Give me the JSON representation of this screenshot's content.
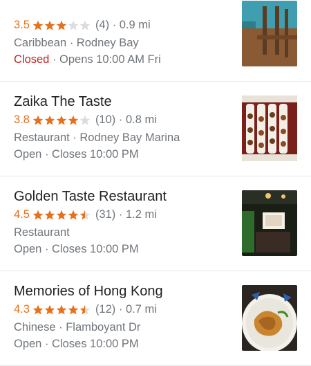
{
  "results": [
    {
      "name": "",
      "rating": "3.5",
      "stars": 3,
      "reviews": "(4)",
      "distance": "0.9 mi",
      "category": "Caribbean · Rodney Bay",
      "status": "Closed",
      "hours": " · Opens 10:00 AM Fri",
      "thumb_icon": "restaurant-interior-photo"
    },
    {
      "name": "Zaika The Taste",
      "rating": "3.8",
      "stars": 4,
      "reviews": "(10)",
      "distance": "0.8 mi",
      "category": "Restaurant · Rodney Bay Marina",
      "status": "Open",
      "hours": " · Closes 10:00 PM",
      "thumb_icon": "food-platter-photo"
    },
    {
      "name": "Golden Taste Restaurant",
      "rating": "4.5",
      "stars": 4.5,
      "reviews": "(31)",
      "distance": "1.2 mi",
      "category": "Restaurant",
      "status": "Open",
      "hours": " · Closes 10:00 PM",
      "thumb_icon": "restaurant-night-photo"
    },
    {
      "name": "Memories of Hong Kong",
      "rating": "4.3",
      "stars": 4.5,
      "reviews": "(12)",
      "distance": "0.7 mi",
      "category": "Chinese · Flamboyant Dr",
      "status": "Open",
      "hours": " · Closes 10:00 PM",
      "thumb_icon": "chinese-dish-photo"
    }
  ],
  "colors": {
    "star": "#e7711b",
    "star_empty": "#dadce0",
    "closed": "#c5221f",
    "secondary_text": "#70757a"
  }
}
